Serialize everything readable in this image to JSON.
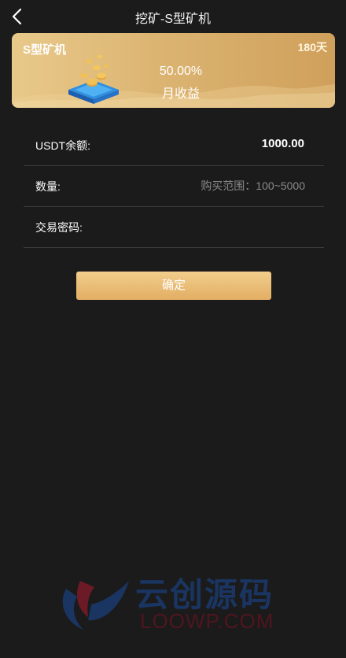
{
  "header": {
    "title": "挖矿-S型矿机"
  },
  "card": {
    "name": "S型矿机",
    "days": "180天",
    "rate": "50.00%",
    "rate_label": "月收益"
  },
  "form": {
    "balance_label": "USDT余额:",
    "balance_value": "1000.00",
    "quantity_label": "数量:",
    "quantity_placeholder": "购买范围：100~5000",
    "password_label": "交易密码:",
    "password_placeholder": ""
  },
  "actions": {
    "confirm_label": "确定"
  },
  "watermark": {
    "cn": "云创源码",
    "en": "LOOWP.COM"
  },
  "colors": {
    "background": "#1b1b1b",
    "card_gold": "#dcb472",
    "button_gold": "#e2ae63"
  }
}
